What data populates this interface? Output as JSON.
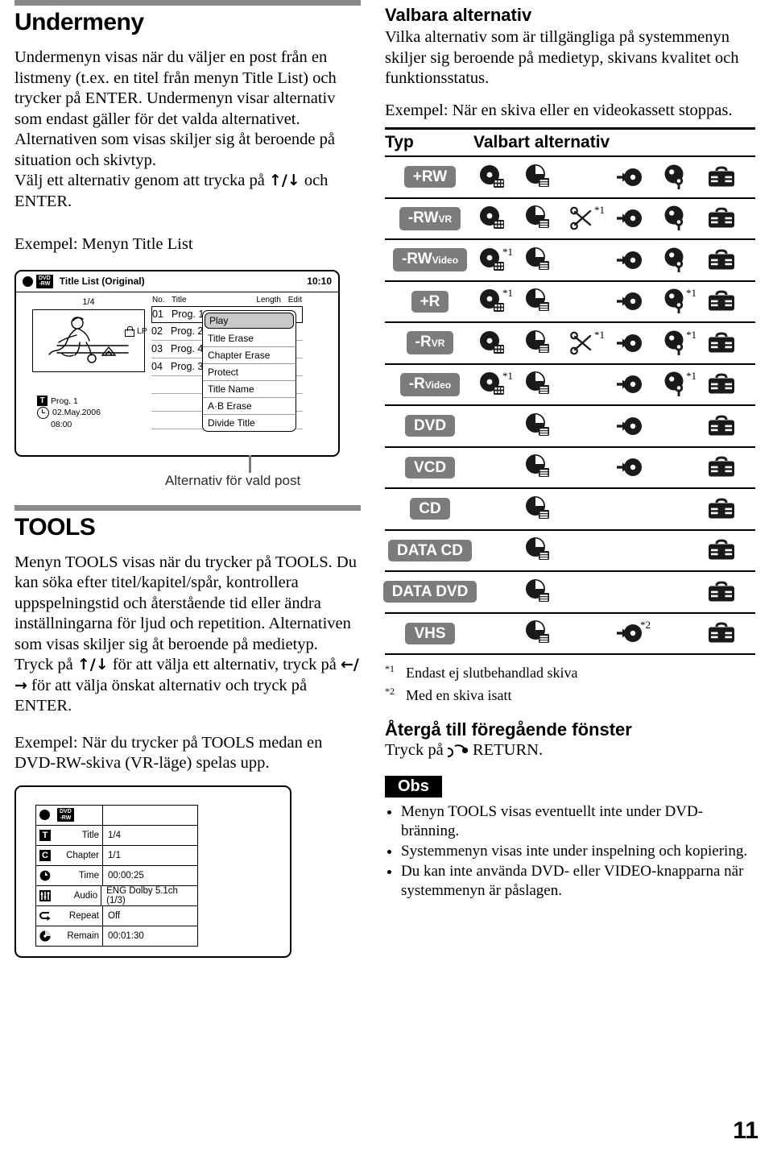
{
  "left": {
    "heading": "Undermeny",
    "paragraph1_a": "Undermenyn visas när du väljer en post från en listmeny (t.ex. en titel från menyn Title List) och trycker på ENTER. Undermenyn visar alternativ som endast gäller för det valda alternativet. Alternativen som visas skiljer sig åt beroende på situation och skivtyp.",
    "paragraph1_b_pre": "Välj ett alternativ genom att trycka på ",
    "paragraph1_b_arrows": "↑/↓",
    "paragraph1_b_post": " och ENTER.",
    "example_label": "Exempel: Menyn Title List",
    "tools_heading": "TOOLS",
    "tools_p1": "Menyn TOOLS visas när du trycker på TOOLS. Du kan söka efter titel/kapitel/spår, kontrollera uppspelningstid och återstående tid eller ändra inställningarna för ljud och repetition. Alternativen som visas skiljer sig åt beroende på medietyp.",
    "tools_p2_pre": "Tryck på ",
    "tools_p2_arrows1": "↑/↓",
    "tools_p2_mid": " för att välja ett alternativ, tryck på ",
    "tools_p2_arrows2": "←/→",
    "tools_p2_post": " för att välja önskat alternativ och tryck på ENTER.",
    "tools_example": "Exempel: När du trycker på TOOLS medan en DVD-RW-skiva (VR-läge) spelas upp."
  },
  "titlelist": {
    "disc_badge_line1": "DVD",
    "disc_badge_line2": "-RW",
    "screen_title": "Title List (Original)",
    "clock": "10:10",
    "page_indicator": "1/4",
    "columns": {
      "no": "No.",
      "title": "Title",
      "length": "Length",
      "edit": "Edit"
    },
    "rows": [
      {
        "no": "01",
        "title": "Prog. 1"
      },
      {
        "no": "02",
        "title": "Prog. 2"
      },
      {
        "no": "03",
        "title": "Prog. 4"
      },
      {
        "no": "04",
        "title": "Prog. 3"
      }
    ],
    "meta": {
      "title_badge": "T",
      "title_name": "Prog. 1",
      "date": "02.May.2006",
      "time": "08:00",
      "rec_mode": "LP"
    },
    "popup_items": [
      "Play",
      "Title Erase",
      "Chapter Erase",
      "Protect",
      "Title Name",
      "A·B Erase",
      "Divide Title"
    ],
    "popup_selected": "Play",
    "caption": "Alternativ för vald post"
  },
  "toolsmenu": {
    "disc_badge_line1": "DVD",
    "disc_badge_line2": "-RW",
    "rows": [
      {
        "icon": "title-icon",
        "glyph": "T",
        "label": "Title",
        "value": "1/4"
      },
      {
        "icon": "chapter-icon",
        "glyph": "C",
        "label": "Chapter",
        "value": "1/1"
      },
      {
        "icon": "time-icon",
        "glyph": "",
        "label": "Time",
        "value": "00:00:25"
      },
      {
        "icon": "audio-icon",
        "glyph": "",
        "label": "Audio",
        "value": "ENG Dolby 5.1ch (1/3)"
      },
      {
        "icon": "repeat-icon",
        "glyph": "",
        "label": "Repeat",
        "value": "Off"
      },
      {
        "icon": "remain-icon",
        "glyph": "",
        "label": "Remain",
        "value": "00:01:30"
      }
    ]
  },
  "right": {
    "heading": "Valbara alternativ",
    "paragraph1": "Vilka alternativ som är tillgängliga på systemmenyn skiljer sig beroende på medietyp, skivans kvalitet och funktionsstatus.",
    "paragraph2": "Exempel: När en skiva eller en videokassett stoppas.",
    "table_header": {
      "type": "Typ",
      "options": "Valbart alternativ"
    },
    "columns": [
      "title-list-icon",
      "time-search-icon",
      "scissors-icon",
      "input-select-icon",
      "setup-icon",
      "toolbox-icon"
    ],
    "rows": [
      {
        "type": "+RW",
        "type_sub": "",
        "cells": [
          {
            "icon": "title-list-icon",
            "note": ""
          },
          {
            "icon": "time-search-icon",
            "note": ""
          },
          {
            "icon": "",
            "note": ""
          },
          {
            "icon": "input-select-icon",
            "note": ""
          },
          {
            "icon": "setup-icon",
            "note": ""
          },
          {
            "icon": "toolbox-icon",
            "note": ""
          }
        ]
      },
      {
        "type": "-RW",
        "type_sub": "VR",
        "cells": [
          {
            "icon": "title-list-icon",
            "note": ""
          },
          {
            "icon": "time-search-icon",
            "note": ""
          },
          {
            "icon": "scissors-icon",
            "note": "*1"
          },
          {
            "icon": "input-select-icon",
            "note": ""
          },
          {
            "icon": "setup-icon",
            "note": ""
          },
          {
            "icon": "toolbox-icon",
            "note": ""
          }
        ]
      },
      {
        "type": "-RW",
        "type_sub": "Video",
        "cells": [
          {
            "icon": "title-list-icon",
            "note": "*1"
          },
          {
            "icon": "time-search-icon",
            "note": ""
          },
          {
            "icon": "",
            "note": ""
          },
          {
            "icon": "input-select-icon",
            "note": ""
          },
          {
            "icon": "setup-icon",
            "note": ""
          },
          {
            "icon": "toolbox-icon",
            "note": ""
          }
        ]
      },
      {
        "type": "+R",
        "type_sub": "",
        "cells": [
          {
            "icon": "title-list-icon",
            "note": "*1"
          },
          {
            "icon": "time-search-icon",
            "note": ""
          },
          {
            "icon": "",
            "note": ""
          },
          {
            "icon": "input-select-icon",
            "note": ""
          },
          {
            "icon": "setup-icon",
            "note": "*1"
          },
          {
            "icon": "toolbox-icon",
            "note": ""
          }
        ]
      },
      {
        "type": "-R",
        "type_sub": "VR",
        "cells": [
          {
            "icon": "title-list-icon",
            "note": ""
          },
          {
            "icon": "time-search-icon",
            "note": ""
          },
          {
            "icon": "scissors-icon",
            "note": "*1"
          },
          {
            "icon": "input-select-icon",
            "note": ""
          },
          {
            "icon": "setup-icon",
            "note": "*1"
          },
          {
            "icon": "toolbox-icon",
            "note": ""
          }
        ]
      },
      {
        "type": "-R",
        "type_sub": "Video",
        "cells": [
          {
            "icon": "title-list-icon",
            "note": "*1"
          },
          {
            "icon": "time-search-icon",
            "note": ""
          },
          {
            "icon": "",
            "note": ""
          },
          {
            "icon": "input-select-icon",
            "note": ""
          },
          {
            "icon": "setup-icon",
            "note": "*1"
          },
          {
            "icon": "toolbox-icon",
            "note": ""
          }
        ]
      },
      {
        "type": "DVD",
        "type_sub": "",
        "cells": [
          {
            "icon": "",
            "note": ""
          },
          {
            "icon": "time-search-icon",
            "note": ""
          },
          {
            "icon": "",
            "note": ""
          },
          {
            "icon": "input-select-icon",
            "note": ""
          },
          {
            "icon": "",
            "note": ""
          },
          {
            "icon": "toolbox-icon",
            "note": ""
          }
        ]
      },
      {
        "type": "VCD",
        "type_sub": "",
        "cells": [
          {
            "icon": "",
            "note": ""
          },
          {
            "icon": "time-search-icon",
            "note": ""
          },
          {
            "icon": "",
            "note": ""
          },
          {
            "icon": "input-select-icon",
            "note": ""
          },
          {
            "icon": "",
            "note": ""
          },
          {
            "icon": "toolbox-icon",
            "note": ""
          }
        ]
      },
      {
        "type": "CD",
        "type_sub": "",
        "cells": [
          {
            "icon": "",
            "note": ""
          },
          {
            "icon": "time-search-icon",
            "note": ""
          },
          {
            "icon": "",
            "note": ""
          },
          {
            "icon": "",
            "note": ""
          },
          {
            "icon": "",
            "note": ""
          },
          {
            "icon": "toolbox-icon",
            "note": ""
          }
        ]
      },
      {
        "type": "DATA CD",
        "type_sub": "",
        "cells": [
          {
            "icon": "",
            "note": ""
          },
          {
            "icon": "time-search-icon",
            "note": ""
          },
          {
            "icon": "",
            "note": ""
          },
          {
            "icon": "",
            "note": ""
          },
          {
            "icon": "",
            "note": ""
          },
          {
            "icon": "toolbox-icon",
            "note": ""
          }
        ]
      },
      {
        "type": "DATA DVD",
        "type_sub": "",
        "cells": [
          {
            "icon": "",
            "note": ""
          },
          {
            "icon": "time-search-icon",
            "note": ""
          },
          {
            "icon": "",
            "note": ""
          },
          {
            "icon": "",
            "note": ""
          },
          {
            "icon": "",
            "note": ""
          },
          {
            "icon": "toolbox-icon",
            "note": ""
          }
        ]
      },
      {
        "type": "VHS",
        "type_sub": "",
        "cells": [
          {
            "icon": "",
            "note": ""
          },
          {
            "icon": "time-search-icon",
            "note": ""
          },
          {
            "icon": "",
            "note": ""
          },
          {
            "icon": "input-select-icon",
            "note": "*2"
          },
          {
            "icon": "",
            "note": ""
          },
          {
            "icon": "toolbox-icon",
            "note": ""
          }
        ]
      }
    ],
    "footnotes": [
      {
        "marker": "*1",
        "text": "Endast ej slutbehandlad skiva"
      },
      {
        "marker": "*2",
        "text": "Med en skiva isatt"
      }
    ],
    "return_heading": "Återgå till föregående fönster",
    "return_text_pre": "Tryck på ",
    "return_text_post": " RETURN.",
    "obs_label": "Obs",
    "notes": [
      "Menyn TOOLS visas eventuellt inte under DVD-bränning.",
      "Systemmenyn visas inte under inspelning och kopiering.",
      "Du kan inte använda DVD- eller VIDEO-knapparna när systemmenyn är påslagen."
    ]
  },
  "page_number": "11",
  "colors": {
    "badge_gray": "#7c7c7c",
    "rule_gray": "#8a8a8a",
    "selection_gray": "#c9c9c9"
  }
}
